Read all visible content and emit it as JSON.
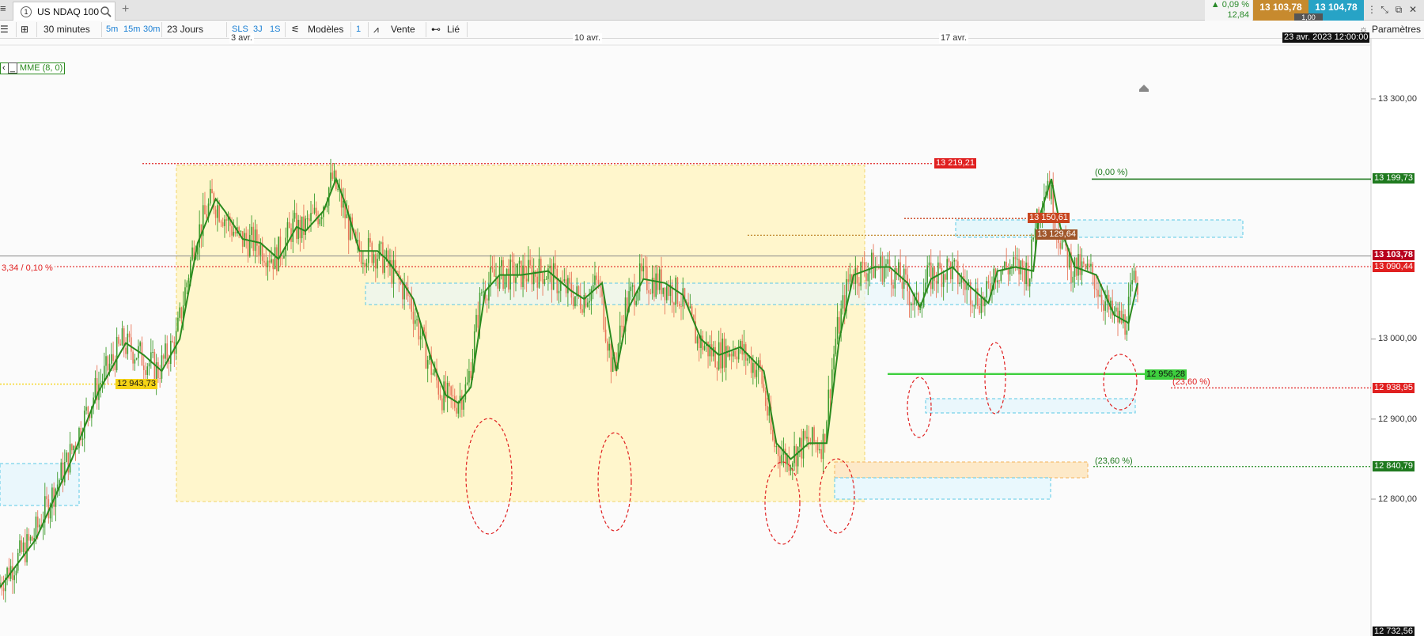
{
  "tabbar": {
    "tab_number": "1",
    "instrument": "US NDAQ 100",
    "add_tab": "+",
    "change_pct": "▲ 0,09 %",
    "change_pts": "12,84",
    "bid": "13 103,78",
    "ask": "13 104,78",
    "spread": "1,00"
  },
  "toolbar": {
    "timeframe": "30 minutes",
    "tf_5m": "5m",
    "tf_15m": "15m",
    "tf_30m": "30m",
    "period": "23 Jours",
    "sls": "SLS",
    "tf_3j": "3J",
    "tf_1s": "1S",
    "models": "Modèles",
    "count": "1",
    "vente": "Vente",
    "lie": "Lié",
    "params": "Paramètres"
  },
  "chart_data": {
    "type": "candlestick",
    "instrument": "US NDAQ 100",
    "interval": "30 minutes",
    "indicator": "MME (8, 0)",
    "crosshair_date": "23 avr. 2023 12:00:00",
    "x_ticks": [
      "3 avr.",
      "10 avr.",
      "17 avr."
    ],
    "y_ticks": [
      "13 300,00",
      "13 000,00",
      "12 900,00",
      "12 800,00"
    ],
    "y_ticks_values": [
      13300,
      13000,
      12900,
      12800
    ],
    "ylim": [
      12716,
      13420
    ],
    "price_line": {
      "value": 13103.78,
      "label": "13 103,78"
    },
    "reference_line": {
      "value": 13090.44,
      "label": "13 090,44",
      "left_label": "3,34 / 0,10 %"
    },
    "bottom_axis_label": "12 732,56",
    "colors": {
      "up": "#3e9c2e",
      "down": "#e8765a",
      "ema": "#2a8a1e",
      "resistance": "#e02020",
      "support": "#1f8a1f",
      "zone": "#fff6cc"
    },
    "levels": [
      {
        "value": 13219.21,
        "label": "13 219,21",
        "color": "#e02020"
      },
      {
        "value": 13199.73,
        "label": "13 199,73",
        "color": "#1f7a1f"
      },
      {
        "value": 13150.61,
        "label": "13 150,61",
        "color": "#c8441e"
      },
      {
        "value": 13129.64,
        "label": "13 129,64",
        "color": "#a0562a"
      },
      {
        "value": 12956.28,
        "label": "12 956,28",
        "color": "#3ecf3e"
      },
      {
        "value": 12943.73,
        "label": "12 943,73",
        "color": "#f5d316"
      },
      {
        "value": 12938.95,
        "label": "12 938,95",
        "color": "#e02020"
      },
      {
        "value": 12840.79,
        "label": "12 840,79",
        "color": "#1f8a1f"
      }
    ],
    "fib_labels": [
      "(0,00 %)",
      "(23,60 %)",
      "(23,60 %)"
    ],
    "series": [
      {
        "type": "ema",
        "points": [
          [
            0,
            12690
          ],
          [
            20,
            12750
          ],
          [
            40,
            12850
          ],
          [
            55,
            12935
          ],
          [
            70,
            12995
          ],
          [
            80,
            12980
          ],
          [
            90,
            12960
          ],
          [
            100,
            13000
          ],
          [
            110,
            13120
          ],
          [
            120,
            13175
          ],
          [
            125,
            13160
          ],
          [
            135,
            13125
          ],
          [
            145,
            13120
          ],
          [
            155,
            13100
          ],
          [
            165,
            13140
          ],
          [
            170,
            13135
          ],
          [
            180,
            13160
          ],
          [
            187,
            13200
          ],
          [
            192,
            13170
          ],
          [
            200,
            13110
          ],
          [
            210,
            13110
          ],
          [
            215,
            13100
          ],
          [
            220,
            13085
          ],
          [
            230,
            13050
          ],
          [
            240,
            12975
          ],
          [
            248,
            12930
          ],
          [
            255,
            12920
          ],
          [
            262,
            12940
          ],
          [
            270,
            13060
          ],
          [
            278,
            13080
          ],
          [
            290,
            13080
          ],
          [
            305,
            13085
          ],
          [
            318,
            13060
          ],
          [
            325,
            13050
          ],
          [
            335,
            13070
          ],
          [
            343,
            12960
          ],
          [
            350,
            13040
          ],
          [
            358,
            13075
          ],
          [
            370,
            13070
          ],
          [
            380,
            13055
          ],
          [
            390,
            13000
          ],
          [
            400,
            12980
          ],
          [
            412,
            12990
          ],
          [
            425,
            12960
          ],
          [
            432,
            12870
          ],
          [
            440,
            12850
          ],
          [
            450,
            12870
          ],
          [
            460,
            12870
          ],
          [
            467,
            13000
          ],
          [
            475,
            13080
          ],
          [
            487,
            13090
          ],
          [
            495,
            13090
          ],
          [
            505,
            13070
          ],
          [
            512,
            13040
          ],
          [
            518,
            13075
          ],
          [
            530,
            13090
          ],
          [
            540,
            13065
          ],
          [
            550,
            13045
          ],
          [
            555,
            13085
          ],
          [
            565,
            13090
          ],
          [
            575,
            13085
          ],
          [
            578,
            13150
          ],
          [
            585,
            13200
          ],
          [
            590,
            13140
          ],
          [
            598,
            13090
          ],
          [
            610,
            13080
          ],
          [
            620,
            13030
          ],
          [
            628,
            13020
          ],
          [
            633,
            13070
          ]
        ]
      },
      {
        "type": "candles",
        "values": []
      }
    ]
  }
}
